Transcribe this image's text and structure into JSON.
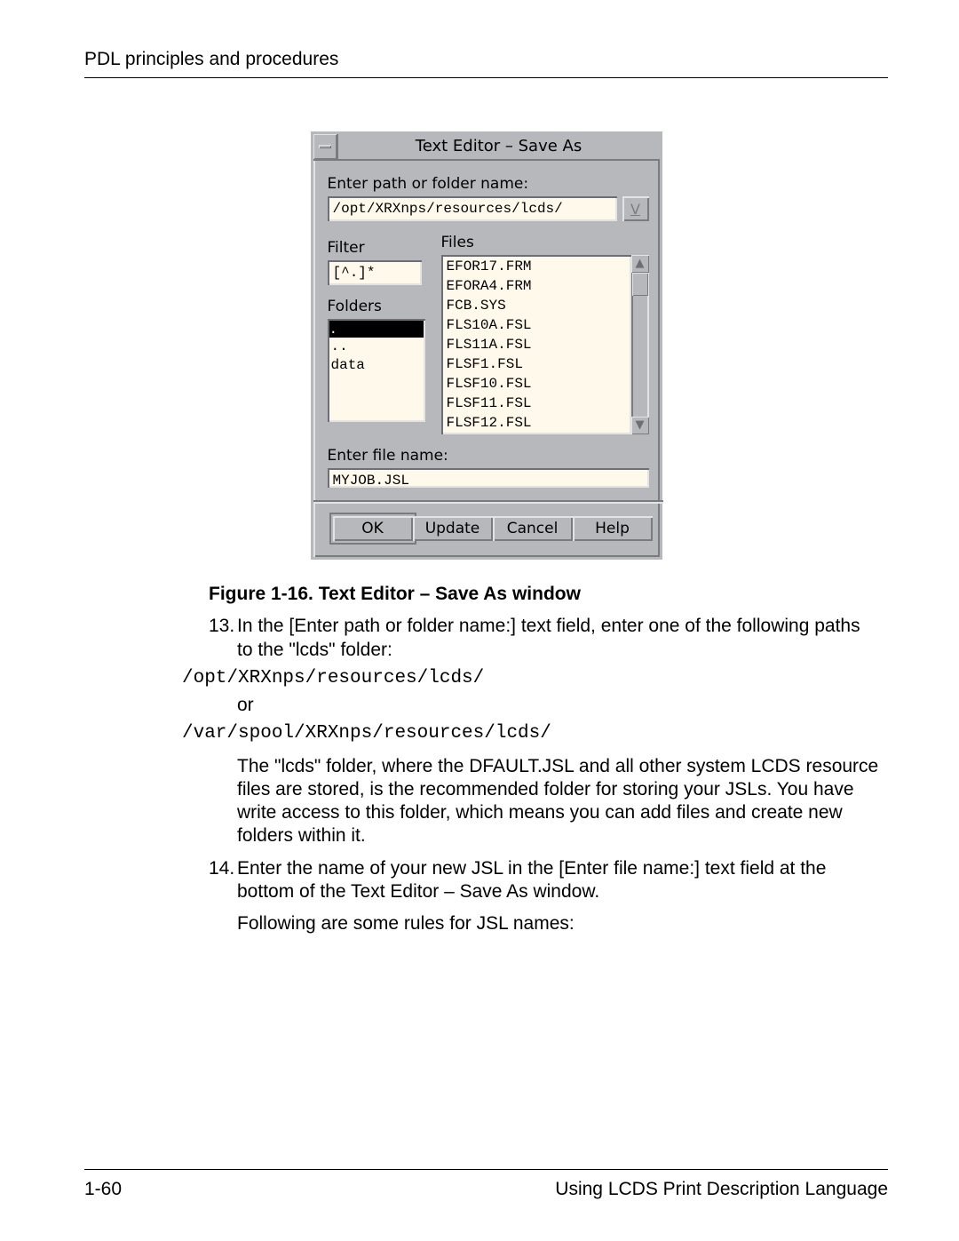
{
  "header": {
    "title": "PDL principles and procedures"
  },
  "dialog": {
    "title": "Text Editor – Save As",
    "path_label": "Enter path or folder name:",
    "path_value": "/opt/XRXnps/resources/lcds/",
    "filter_label": "Filter",
    "filter_value": "[^.]*",
    "folders_label": "Folders",
    "folders": {
      "selected": ".",
      "items": [
        "..",
        "data"
      ]
    },
    "files_label": "Files",
    "files": [
      "EFOR17.FRM",
      "EFORA4.FRM",
      "FCB.SYS",
      "FLS10A.FSL",
      "FLS11A.FSL",
      "FLSF1.FSL",
      "FLSF10.FSL",
      "FLSF11.FSL",
      "FLSF12.FSL"
    ],
    "filename_label": "Enter file name:",
    "filename_value": "MYJOB.JSL",
    "buttons": {
      "ok": "OK",
      "update": "Update",
      "cancel": "Cancel",
      "help": "Help"
    }
  },
  "body": {
    "caption": "Figure 1-16.  Text Editor – Save As window",
    "step13_num": "13.",
    "step13_text": "In the [Enter path or folder name:] text field, enter one of the following paths to the \"lcds\" folder:",
    "path1": "/opt/XRXnps/resources/lcds/",
    "or": "or",
    "path2": "/var/spool/XRXnps/resources/lcds/",
    "lcds_para": "The \"lcds\" folder, where the DFAULT.JSL and all other system LCDS resource files are stored, is the recommended folder for storing your JSLs. You have write access to this folder, which means you can add files and create new folders within it.",
    "step14_num": "14.",
    "step14_text": "Enter the name of your new JSL in the [Enter file name:] text field at the bottom of the Text Editor – Save As window.",
    "rules_intro": "Following are some rules for JSL names:"
  },
  "footer": {
    "page": "1-60",
    "book": "Using LCDS Print Description Language"
  }
}
